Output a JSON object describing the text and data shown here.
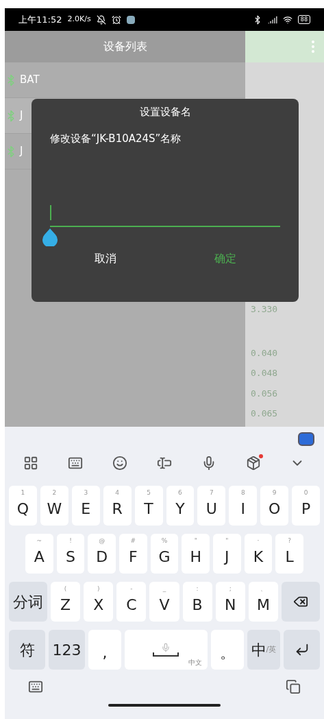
{
  "status_bar": {
    "time": "上午11:52",
    "speed": "2.0K/s",
    "battery": "88"
  },
  "header": {
    "title": "设备列表"
  },
  "devices": [
    {
      "name": "BAT"
    },
    {
      "name": "J"
    },
    {
      "name": "J"
    }
  ],
  "readings": [
    "3.330",
    "0.040",
    "0.048",
    "0.056",
    "0.065"
  ],
  "dialog": {
    "title": "设置设备名",
    "message": "修改设备“JK-B10A24S”名称",
    "buttons": [
      {
        "label": "取消",
        "kind": "cancel"
      },
      {
        "label": "确定",
        "kind": "confirm"
      }
    ]
  },
  "keyboard": {
    "rows": [
      {
        "keys": [
          {
            "kind": "letter",
            "label": "Q",
            "hint": "1"
          },
          {
            "kind": "letter",
            "label": "W",
            "hint": "2"
          },
          {
            "kind": "letter",
            "label": "E",
            "hint": "3"
          },
          {
            "kind": "letter",
            "label": "R",
            "hint": "4"
          },
          {
            "kind": "letter",
            "label": "T",
            "hint": "5"
          },
          {
            "kind": "letter",
            "label": "Y",
            "hint": "6"
          },
          {
            "kind": "letter",
            "label": "U",
            "hint": "7"
          },
          {
            "kind": "letter",
            "label": "I",
            "hint": "8"
          },
          {
            "kind": "letter",
            "label": "O",
            "hint": "9"
          },
          {
            "kind": "letter",
            "label": "P",
            "hint": "0"
          }
        ]
      },
      {
        "keys": [
          {
            "kind": "letter",
            "label": "A",
            "hint": "~"
          },
          {
            "kind": "letter",
            "label": "S",
            "hint": "!"
          },
          {
            "kind": "letter",
            "label": "D",
            "hint": "@"
          },
          {
            "kind": "letter",
            "label": "F",
            "hint": "#"
          },
          {
            "kind": "letter",
            "label": "G",
            "hint": "%"
          },
          {
            "kind": "letter",
            "label": "H",
            "hint": "\""
          },
          {
            "kind": "letter",
            "label": "J",
            "hint": "\""
          },
          {
            "kind": "letter",
            "label": "K",
            "hint": "·"
          },
          {
            "kind": "letter",
            "label": "L",
            "hint": "?"
          }
        ]
      },
      {
        "keys": [
          {
            "kind": "function",
            "label": "分词"
          },
          {
            "kind": "letter",
            "label": "Z",
            "hint": "("
          },
          {
            "kind": "letter",
            "label": "X",
            "hint": ")"
          },
          {
            "kind": "letter",
            "label": "C",
            "hint": "-"
          },
          {
            "kind": "letter",
            "label": "V",
            "hint": "_"
          },
          {
            "kind": "letter",
            "label": "B",
            "hint": ":"
          },
          {
            "kind": "letter",
            "label": "N",
            "hint": ";"
          },
          {
            "kind": "letter",
            "label": "M",
            "hint": "、"
          },
          {
            "kind": "backspace"
          }
        ]
      },
      {
        "keys": [
          {
            "kind": "function",
            "label": "符"
          },
          {
            "kind": "function",
            "label": "123"
          },
          {
            "kind": "letter",
            "label": ","
          },
          {
            "kind": "space",
            "hint": "中文"
          },
          {
            "kind": "letter",
            "label": "。"
          },
          {
            "kind": "lang",
            "label": "中",
            "hint": "/英"
          },
          {
            "kind": "enter"
          }
        ]
      }
    ]
  }
}
